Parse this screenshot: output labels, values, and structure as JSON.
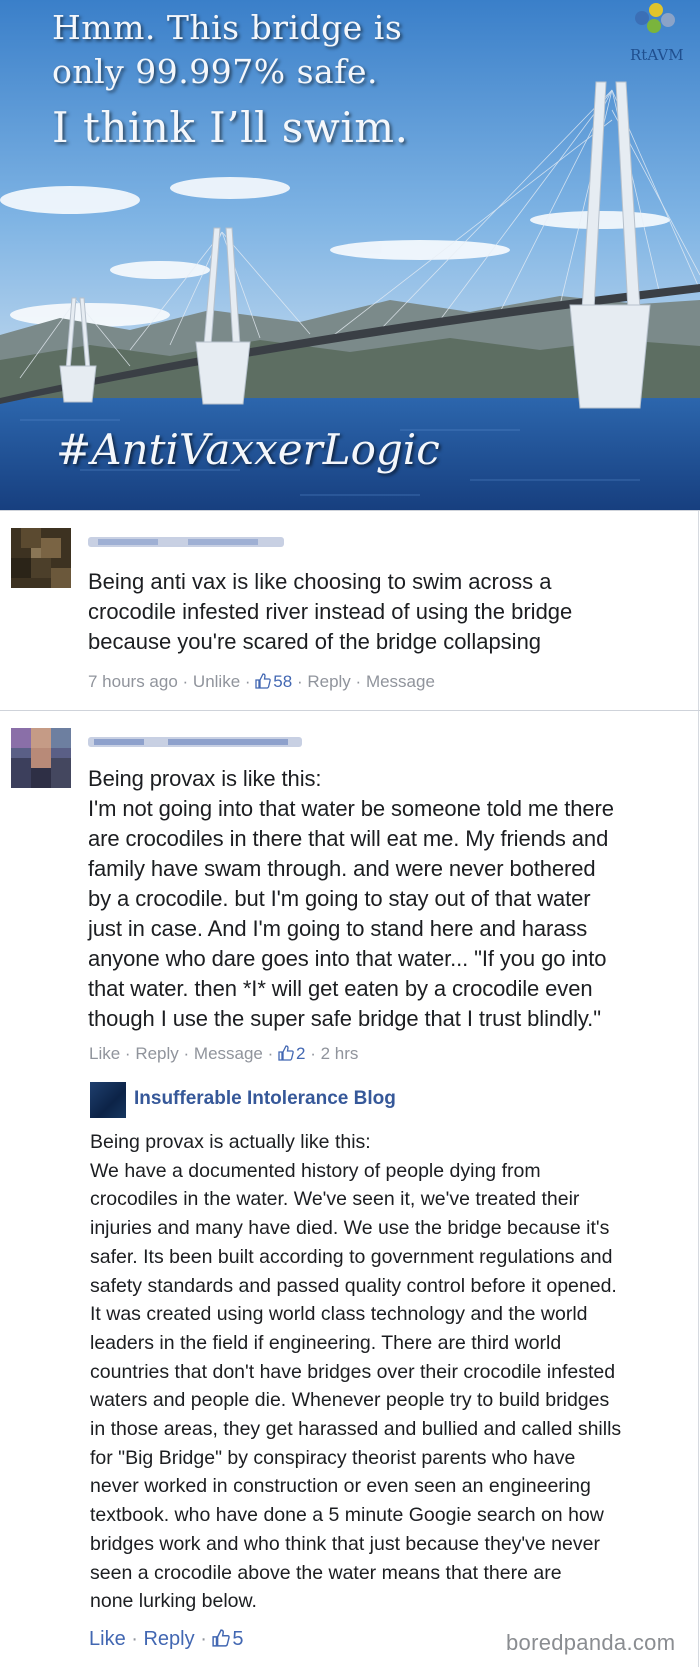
{
  "meme": {
    "line1": "Hmm. This bridge is",
    "line2": "only 99.997% safe.",
    "line3": "I think I’ll swim.",
    "hashtag": "#AntiVaxxerLogic",
    "logo_text": "RtAVM",
    "logo_colors": [
      "#3b6fb6",
      "#e0c42b",
      "#7ab43c",
      "#8aa3c8"
    ]
  },
  "comments": [
    {
      "text": "Being anti vax is like choosing to swim across a\ncrocodile infested river instead of using the bridge\nbecause you're scared of the bridge collapsing",
      "time": "7 hours ago",
      "unlike": "Unlike",
      "likes": "58",
      "reply": "Reply",
      "message": "Message"
    },
    {
      "text": "Being provax is like this:\nI'm not going into that water be someone told me there\nare crocodiles in there that will eat me. My friends and\nfamily have swam through. and were never bothered\nby a crocodile. but I'm going to stay out of that water\njust in case. And I'm going to stand here and harass\nanyone who dare goes into that water... \"If you go into\nthat water. then *I* will get eaten by a crocodile even\nthough I use the super safe bridge that I trust blindly.\"",
      "like": "Like",
      "reply": "Reply",
      "message": "Message",
      "likes": "2",
      "time": "2 hrs"
    }
  ],
  "reply": {
    "author": "Insufferable Intolerance Blog",
    "text": "Being provax is actually like this:\nWe have a documented history of people dying from\ncrocodiles in the water. We've seen it, we've treated their\ninjuries and many have died. We use the bridge because it's\nsafer. Its been built according to government regulations and\nsafety standards and passed quality control before it opened.\nIt was created using world class technology and the world\nleaders in the field if engineering. There are third world\ncountries that don't have bridges over their crocodile infested\nwaters and people die. Whenever people try to build bridges\nin those areas, they get harassed and bullied and called shills\nfor \"Big Bridge\" by conspiracy theorist parents who have\nnever worked in construction or even seen an engineering\ntextbook. who have done a 5 minute Googie search on how\nbridges work and who think that just because they've never\nseen a crocodile above the water means that there are\nnone lurking below.",
    "like": "Like",
    "reply": "Reply",
    "likes": "5"
  },
  "watermark": "boredpanda.com",
  "colors": {
    "link_blue": "#4267b2",
    "meta_gray": "#90949c",
    "sky_top": "#3f86cf",
    "water": "#1c4f94"
  }
}
